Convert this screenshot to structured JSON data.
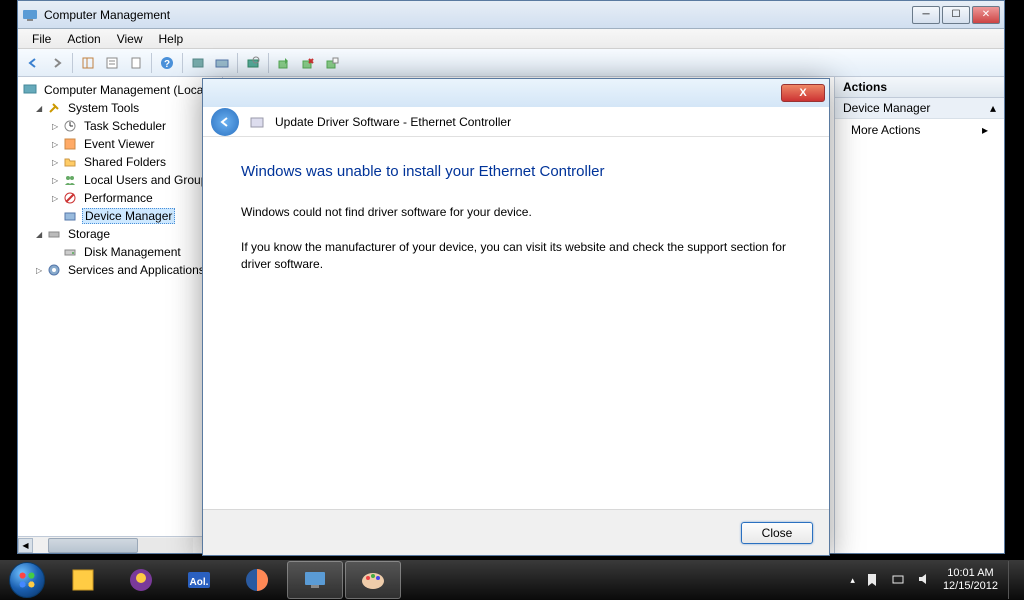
{
  "window": {
    "title": "Computer Management",
    "menu": [
      "File",
      "Action",
      "View",
      "Help"
    ]
  },
  "tree": {
    "root": "Computer Management (Local)",
    "system_tools": "System Tools",
    "task_scheduler": "Task Scheduler",
    "event_viewer": "Event Viewer",
    "shared_folders": "Shared Folders",
    "local_users": "Local Users and Groups",
    "performance": "Performance",
    "device_manager": "Device Manager",
    "storage": "Storage",
    "disk_mgmt": "Disk Management",
    "services": "Services and Applications"
  },
  "actions": {
    "header": "Actions",
    "group": "Device Manager",
    "more": "More Actions"
  },
  "dialog": {
    "crumb": "Update Driver Software - Ethernet Controller",
    "heading": "Windows was unable to install your Ethernet Controller",
    "p1": "Windows could not find driver software for your device.",
    "p2": "If you know the manufacturer of your device, you can visit its website and check the support section for driver software.",
    "close_btn": "Close",
    "close_x": "X"
  },
  "taskbar": {
    "time": "10:01 AM",
    "date": "12/15/2012"
  }
}
